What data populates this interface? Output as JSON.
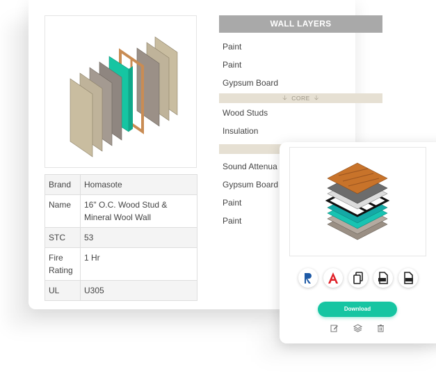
{
  "properties": [
    {
      "key": "Brand",
      "value": "Homasote"
    },
    {
      "key": "Name",
      "value": "16\" O.C. Wood Stud & Mineral Wool Wall"
    },
    {
      "key": "STC",
      "value": "53"
    },
    {
      "key": "Fire Rating",
      "value": "1 Hr"
    },
    {
      "key": "UL",
      "value": "U305"
    }
  ],
  "layers": {
    "header": "WALL LAYERS",
    "outer": [
      "Paint",
      "Paint",
      "Gypsum Board"
    ],
    "core_label": "CORE",
    "core": [
      "Wood Studs",
      "Insulation"
    ],
    "inner": [
      "Sound Attenua",
      "Gypsum Board",
      "Paint",
      "Paint"
    ]
  },
  "float_card": {
    "icons": [
      "revit-icon",
      "autocad-icon",
      "copy-file-icon",
      "pdf-file-icon",
      "dwg-file-icon"
    ],
    "download_label": "Download",
    "actions": [
      "edit-icon",
      "layers-icon",
      "trash-icon"
    ]
  },
  "colors": {
    "accent": "#16c5a2",
    "header_gray": "#a9a9a9",
    "core_beige": "#e6e0d3"
  }
}
